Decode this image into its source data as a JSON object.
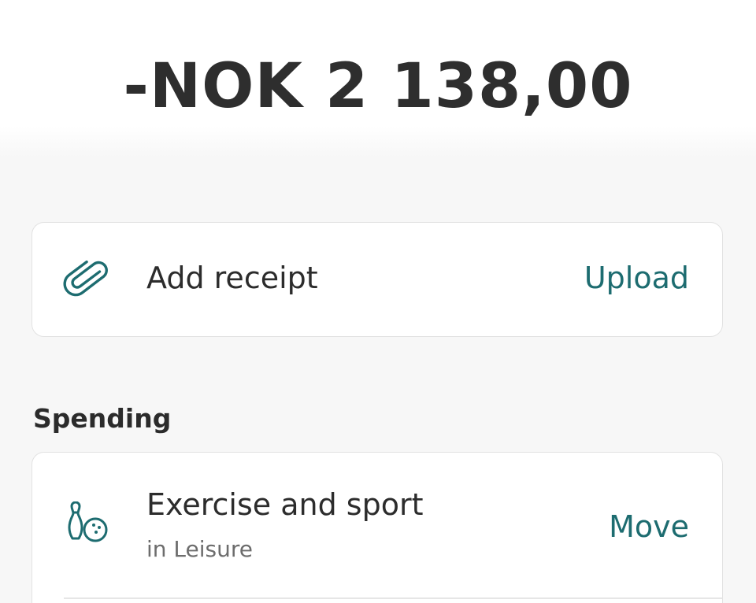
{
  "transaction": {
    "amount": "-NOK 2 138,00"
  },
  "receipt": {
    "icon": "paperclip-icon",
    "label": "Add receipt",
    "action": "Upload"
  },
  "spending": {
    "heading": "Spending",
    "category": {
      "icon": "bowling-icon",
      "title": "Exercise and sport",
      "subtitle": "in Leisure",
      "action": "Move"
    }
  },
  "colors": {
    "accent": "#1d6c70",
    "text": "#2b2b2b",
    "muted": "#6d6d6d",
    "background": "#f7f7f7",
    "card": "#ffffff"
  }
}
